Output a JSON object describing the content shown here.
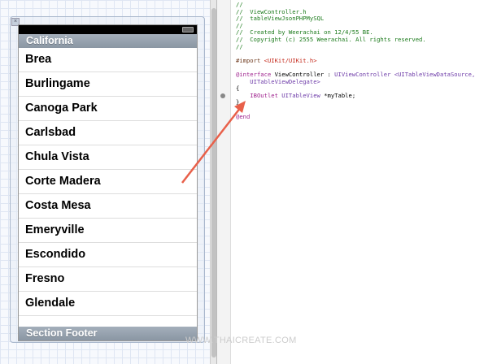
{
  "table": {
    "section_header": "California",
    "section_footer": "Section Footer",
    "rows": [
      "Brea",
      "Burlingame",
      "Canoga Park",
      "Carlsbad",
      "Chula Vista",
      "Corte Madera",
      "Costa Mesa",
      "Emeryville",
      "Escondido",
      "Fresno",
      "Glendale"
    ]
  },
  "code": {
    "l1": "//",
    "l2": "//  ViewController.h",
    "l3": "//  tableViewJsonPHPMySQL",
    "l4": "//",
    "l5": "//  Created by Weerachai on 12/4/55 BE.",
    "l6": "//  Copyright (c) 2555 Weerachai. All rights reserved.",
    "l7": "//",
    "import_kw": "#import ",
    "import_path": "<UIKit/UIKit.h>",
    "interface_kw": "@interface",
    "interface_name": " ViewController : ",
    "superclass": "UIViewController",
    "protocols1": " <UITableViewDataSource,",
    "protocols2": "    UITableViewDelegate>",
    "open_brace": "{",
    "outlet_kw": "    IBOutlet",
    "outlet_type": " UITableView",
    "outlet_var": " *myTable;",
    "close_brace": "}",
    "end_kw": "@end"
  },
  "watermark": "WWW.THAICREATE.COM",
  "colors": {
    "arrow": "#e8604a"
  }
}
